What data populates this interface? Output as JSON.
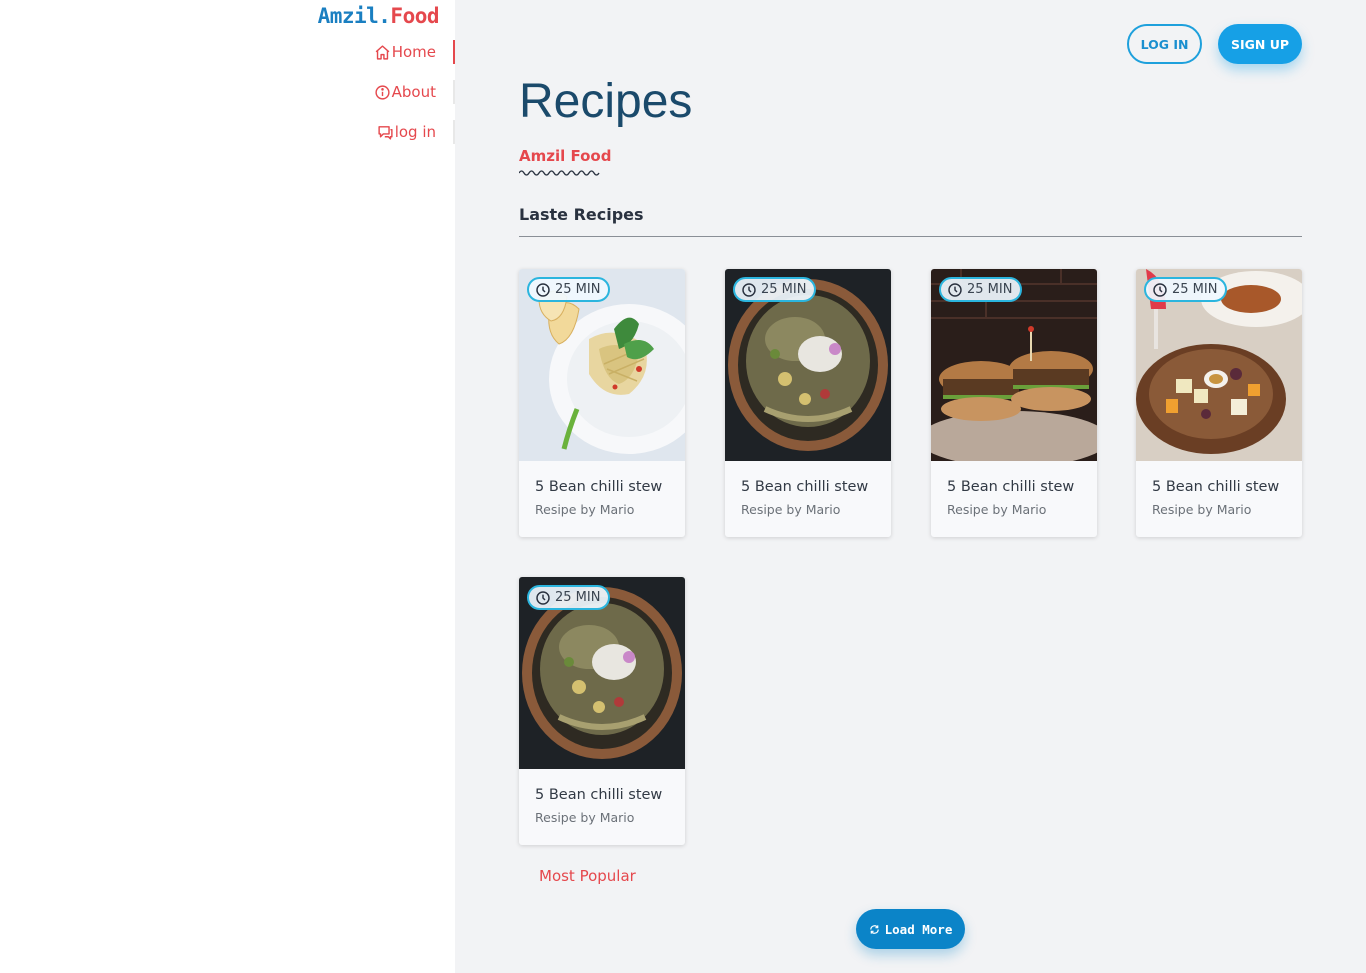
{
  "brand": {
    "part1": "Amzil.",
    "part2": "Food"
  },
  "nav": [
    {
      "label": "Home",
      "icon": "home-icon",
      "active": true
    },
    {
      "label": "About",
      "icon": "info-icon",
      "active": false
    },
    {
      "label": "log in",
      "icon": "chat-icon",
      "active": false
    }
  ],
  "header": {
    "login_label": "LOG IN",
    "signup_label": "SIGN UP"
  },
  "page": {
    "title": "Recipes",
    "subtitle": "Amzil Food",
    "section_title": "Laste Recipes"
  },
  "recipes": [
    {
      "time": "25 MIN",
      "title": "5 Bean chilli stew",
      "author": "Resipe by Mario",
      "image": "salad-plate"
    },
    {
      "time": "25 MIN",
      "title": "5 Bean chilli stew",
      "author": "Resipe by Mario",
      "image": "grain-bowl"
    },
    {
      "time": "25 MIN",
      "title": "5 Bean chilli stew",
      "author": "Resipe by Mario",
      "image": "burgers"
    },
    {
      "time": "25 MIN",
      "title": "5 Bean chilli stew",
      "author": "Resipe by Mario",
      "image": "cheese-board"
    },
    {
      "time": "25 MIN",
      "title": "5 Bean chilli stew",
      "author": "Resipe by Mario",
      "image": "grain-bowl"
    }
  ],
  "most_popular_label": "Most Popular",
  "load_more_label": "Load More",
  "colors": {
    "accent_red": "#e5484d",
    "accent_blue": "#16a0e6",
    "title_navy": "#1b4a6b"
  }
}
